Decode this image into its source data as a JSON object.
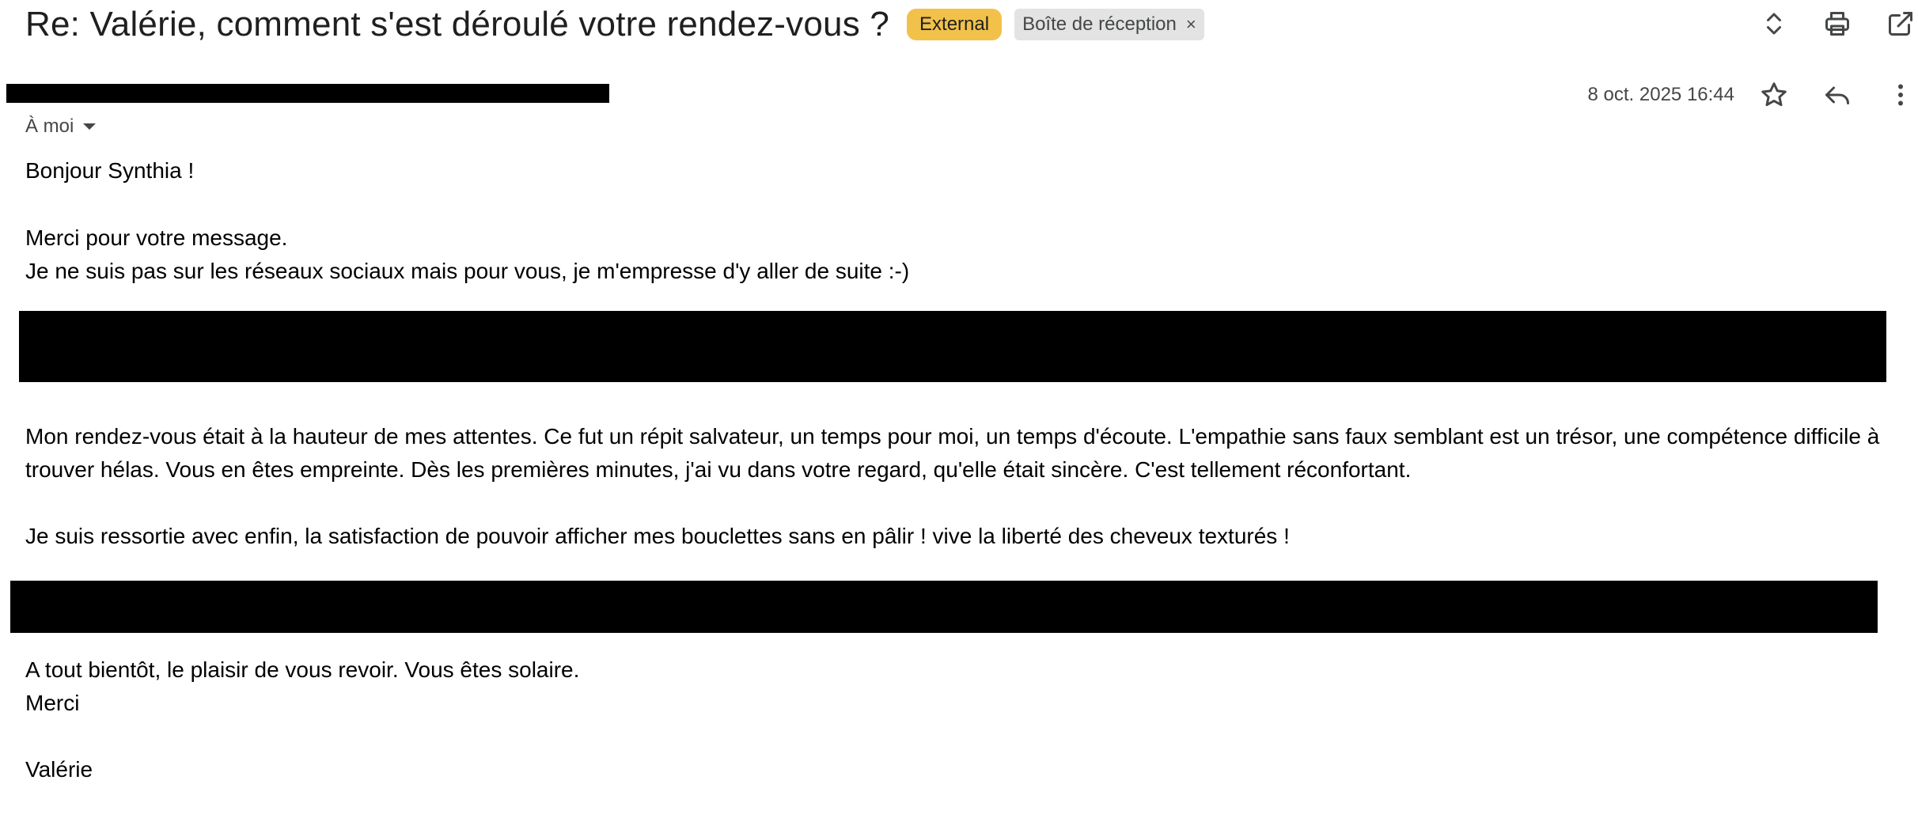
{
  "subject": "Re: Valérie, comment s'est déroulé votre rendez-vous ?",
  "labels": {
    "external": "External",
    "inbox": "Boîte de réception",
    "remove": "×"
  },
  "colors": {
    "external_label": "#f2c14a",
    "inbox_label": "#e3e3e3",
    "redaction": "#000000"
  },
  "top_icons": [
    "expand-collapse-icon",
    "print-icon",
    "open-new-window-icon"
  ],
  "message": {
    "date": "8 oct. 2025 16:44",
    "recipient": "À moi",
    "header_icons": [
      "star-icon",
      "reply-icon",
      "more-vert-icon"
    ],
    "body": {
      "greeting": "Bonjour Synthia !",
      "line1": "Merci pour votre message.",
      "line2": "Je ne suis pas sur les réseaux sociaux mais pour vous, je m'empresse d'y aller de suite :-)",
      "para1": "Mon rendez-vous était à la hauteur de mes attentes. Ce fut un répit salvateur, un temps pour moi, un temps d'écoute. L'empathie sans faux semblant est un trésor, une compétence difficile à trouver hélas. Vous en êtes empreinte. Dès les premières minutes, j'ai vu dans votre regard, qu'elle était sincère. C'est tellement réconfortant.",
      "para2": "Je suis ressortie avec enfin, la satisfaction de pouvoir afficher mes bouclettes sans en pâlir ! vive la liberté des cheveux texturés !",
      "closing1": "A tout bientôt, le plaisir de vous revoir. Vous êtes solaire.",
      "closing2": "Merci",
      "signature": "Valérie"
    }
  }
}
